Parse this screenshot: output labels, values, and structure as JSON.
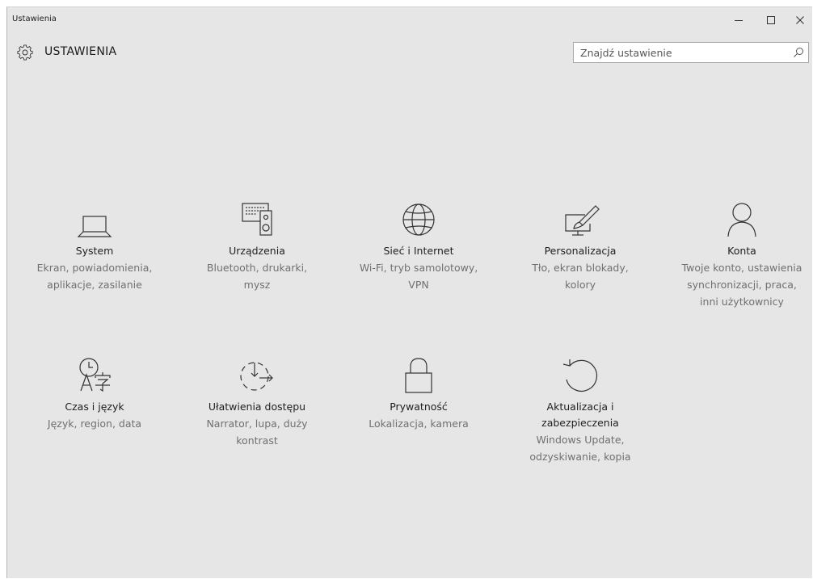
{
  "window": {
    "title": "Ustawienia"
  },
  "header": {
    "title": "USTAWIENIA",
    "icon": "gear-icon"
  },
  "search": {
    "placeholder": "Znajdź ustawienie",
    "value": ""
  },
  "tiles": [
    {
      "id": "system",
      "icon": "laptop-icon",
      "name": "System",
      "desc1": "Ekran, powiadomienia,",
      "desc2": "aplikacje, zasilanie",
      "desc3": ""
    },
    {
      "id": "devices",
      "icon": "devices-icon",
      "name": "Urządzenia",
      "desc1": "Bluetooth, drukarki,",
      "desc2": "mysz",
      "desc3": ""
    },
    {
      "id": "network",
      "icon": "globe-icon",
      "name": "Sieć i Internet",
      "desc1": "Wi-Fi, tryb samolotowy,",
      "desc2": "VPN",
      "desc3": ""
    },
    {
      "id": "personalization",
      "icon": "paint-icon",
      "name": "Personalizacja",
      "desc1": "Tło, ekran blokady,",
      "desc2": "kolory",
      "desc3": ""
    },
    {
      "id": "accounts",
      "icon": "person-icon",
      "name": "Konta",
      "desc1": "Twoje konto, ustawienia",
      "desc2": "synchronizacji, praca,",
      "desc3": "inni użytkownicy"
    },
    {
      "id": "time-language",
      "icon": "time-language-icon",
      "name": "Czas i język",
      "desc1": "Język, region, data",
      "desc2": "",
      "desc3": ""
    },
    {
      "id": "ease-of-access",
      "icon": "ease-of-access-icon",
      "name": "Ułatwienia dostępu",
      "desc1": "Narrator, lupa, duży",
      "desc2": "kontrast",
      "desc3": ""
    },
    {
      "id": "privacy",
      "icon": "lock-icon",
      "name": "Prywatność",
      "desc1": "Lokalizacja, kamera",
      "desc2": "",
      "desc3": ""
    },
    {
      "id": "update-security",
      "icon": "refresh-icon",
      "name": "Aktualizacja i",
      "name2": "zabezpieczenia",
      "desc1": "Windows Update,",
      "desc2": "odzyskiwanie, kopia",
      "desc3": ""
    }
  ]
}
